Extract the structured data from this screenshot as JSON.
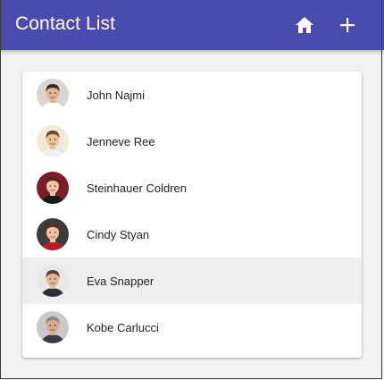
{
  "appbar": {
    "title": "Contact List",
    "home_icon": "home-icon",
    "add_icon": "plus-icon",
    "color": "#4b4aad"
  },
  "contacts": [
    {
      "name": "John Najmi",
      "avatar_bg": "#d9d6d2",
      "skin": "#e0b48f",
      "hair": "#3b2a20",
      "shirt": "#ffffff"
    },
    {
      "name": "Jenneve Ree",
      "avatar_bg": "#f1ead8",
      "skin": "#e9c29a",
      "hair": "#6a4a2a",
      "shirt": "#eef0f4"
    },
    {
      "name": "Steinhauer Coldren",
      "avatar_bg": "#7b1d2a",
      "skin": "#f0c6a8",
      "hair": "#4a2b1e",
      "shirt": "#1a1a1a"
    },
    {
      "name": "Cindy Styan",
      "avatar_bg": "#3c3c3c",
      "skin": "#edc3a3",
      "hair": "#5a3220",
      "shirt": "#b71c2a"
    },
    {
      "name": "Eva Snapper",
      "avatar_bg": "#e8e8e8",
      "skin": "#e2b796",
      "hair": "#5c4030",
      "shirt": "#2c2f38"
    },
    {
      "name": "Kobe Carlucci",
      "avatar_bg": "#c9c9c9",
      "skin": "#d8a98a",
      "hair": "#8a8a8a",
      "shirt": "#3a3d44"
    }
  ],
  "selected_index": 4
}
